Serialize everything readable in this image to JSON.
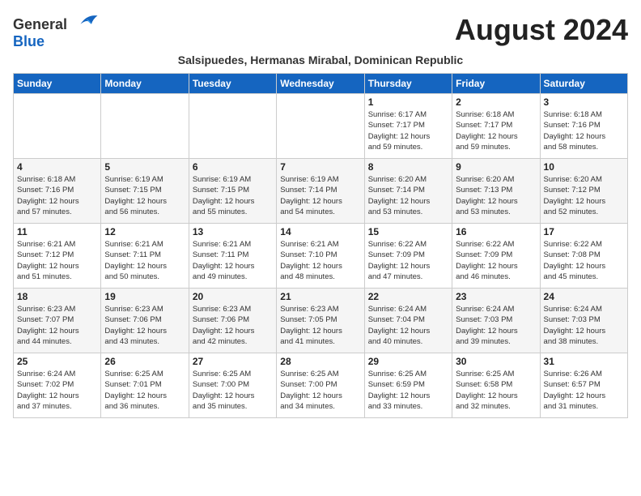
{
  "header": {
    "logo_general": "General",
    "logo_blue": "Blue",
    "month_title": "August 2024",
    "subtitle": "Salsipuedes, Hermanas Mirabal, Dominican Republic"
  },
  "weekdays": [
    "Sunday",
    "Monday",
    "Tuesday",
    "Wednesday",
    "Thursday",
    "Friday",
    "Saturday"
  ],
  "weeks": [
    [
      {
        "day": "",
        "info": ""
      },
      {
        "day": "",
        "info": ""
      },
      {
        "day": "",
        "info": ""
      },
      {
        "day": "",
        "info": ""
      },
      {
        "day": "1",
        "info": "Sunrise: 6:17 AM\nSunset: 7:17 PM\nDaylight: 12 hours\nand 59 minutes."
      },
      {
        "day": "2",
        "info": "Sunrise: 6:18 AM\nSunset: 7:17 PM\nDaylight: 12 hours\nand 59 minutes."
      },
      {
        "day": "3",
        "info": "Sunrise: 6:18 AM\nSunset: 7:16 PM\nDaylight: 12 hours\nand 58 minutes."
      }
    ],
    [
      {
        "day": "4",
        "info": "Sunrise: 6:18 AM\nSunset: 7:16 PM\nDaylight: 12 hours\nand 57 minutes."
      },
      {
        "day": "5",
        "info": "Sunrise: 6:19 AM\nSunset: 7:15 PM\nDaylight: 12 hours\nand 56 minutes."
      },
      {
        "day": "6",
        "info": "Sunrise: 6:19 AM\nSunset: 7:15 PM\nDaylight: 12 hours\nand 55 minutes."
      },
      {
        "day": "7",
        "info": "Sunrise: 6:19 AM\nSunset: 7:14 PM\nDaylight: 12 hours\nand 54 minutes."
      },
      {
        "day": "8",
        "info": "Sunrise: 6:20 AM\nSunset: 7:14 PM\nDaylight: 12 hours\nand 53 minutes."
      },
      {
        "day": "9",
        "info": "Sunrise: 6:20 AM\nSunset: 7:13 PM\nDaylight: 12 hours\nand 53 minutes."
      },
      {
        "day": "10",
        "info": "Sunrise: 6:20 AM\nSunset: 7:12 PM\nDaylight: 12 hours\nand 52 minutes."
      }
    ],
    [
      {
        "day": "11",
        "info": "Sunrise: 6:21 AM\nSunset: 7:12 PM\nDaylight: 12 hours\nand 51 minutes."
      },
      {
        "day": "12",
        "info": "Sunrise: 6:21 AM\nSunset: 7:11 PM\nDaylight: 12 hours\nand 50 minutes."
      },
      {
        "day": "13",
        "info": "Sunrise: 6:21 AM\nSunset: 7:11 PM\nDaylight: 12 hours\nand 49 minutes."
      },
      {
        "day": "14",
        "info": "Sunrise: 6:21 AM\nSunset: 7:10 PM\nDaylight: 12 hours\nand 48 minutes."
      },
      {
        "day": "15",
        "info": "Sunrise: 6:22 AM\nSunset: 7:09 PM\nDaylight: 12 hours\nand 47 minutes."
      },
      {
        "day": "16",
        "info": "Sunrise: 6:22 AM\nSunset: 7:09 PM\nDaylight: 12 hours\nand 46 minutes."
      },
      {
        "day": "17",
        "info": "Sunrise: 6:22 AM\nSunset: 7:08 PM\nDaylight: 12 hours\nand 45 minutes."
      }
    ],
    [
      {
        "day": "18",
        "info": "Sunrise: 6:23 AM\nSunset: 7:07 PM\nDaylight: 12 hours\nand 44 minutes."
      },
      {
        "day": "19",
        "info": "Sunrise: 6:23 AM\nSunset: 7:06 PM\nDaylight: 12 hours\nand 43 minutes."
      },
      {
        "day": "20",
        "info": "Sunrise: 6:23 AM\nSunset: 7:06 PM\nDaylight: 12 hours\nand 42 minutes."
      },
      {
        "day": "21",
        "info": "Sunrise: 6:23 AM\nSunset: 7:05 PM\nDaylight: 12 hours\nand 41 minutes."
      },
      {
        "day": "22",
        "info": "Sunrise: 6:24 AM\nSunset: 7:04 PM\nDaylight: 12 hours\nand 40 minutes."
      },
      {
        "day": "23",
        "info": "Sunrise: 6:24 AM\nSunset: 7:03 PM\nDaylight: 12 hours\nand 39 minutes."
      },
      {
        "day": "24",
        "info": "Sunrise: 6:24 AM\nSunset: 7:03 PM\nDaylight: 12 hours\nand 38 minutes."
      }
    ],
    [
      {
        "day": "25",
        "info": "Sunrise: 6:24 AM\nSunset: 7:02 PM\nDaylight: 12 hours\nand 37 minutes."
      },
      {
        "day": "26",
        "info": "Sunrise: 6:25 AM\nSunset: 7:01 PM\nDaylight: 12 hours\nand 36 minutes."
      },
      {
        "day": "27",
        "info": "Sunrise: 6:25 AM\nSunset: 7:00 PM\nDaylight: 12 hours\nand 35 minutes."
      },
      {
        "day": "28",
        "info": "Sunrise: 6:25 AM\nSunset: 7:00 PM\nDaylight: 12 hours\nand 34 minutes."
      },
      {
        "day": "29",
        "info": "Sunrise: 6:25 AM\nSunset: 6:59 PM\nDaylight: 12 hours\nand 33 minutes."
      },
      {
        "day": "30",
        "info": "Sunrise: 6:25 AM\nSunset: 6:58 PM\nDaylight: 12 hours\nand 32 minutes."
      },
      {
        "day": "31",
        "info": "Sunrise: 6:26 AM\nSunset: 6:57 PM\nDaylight: 12 hours\nand 31 minutes."
      }
    ]
  ]
}
